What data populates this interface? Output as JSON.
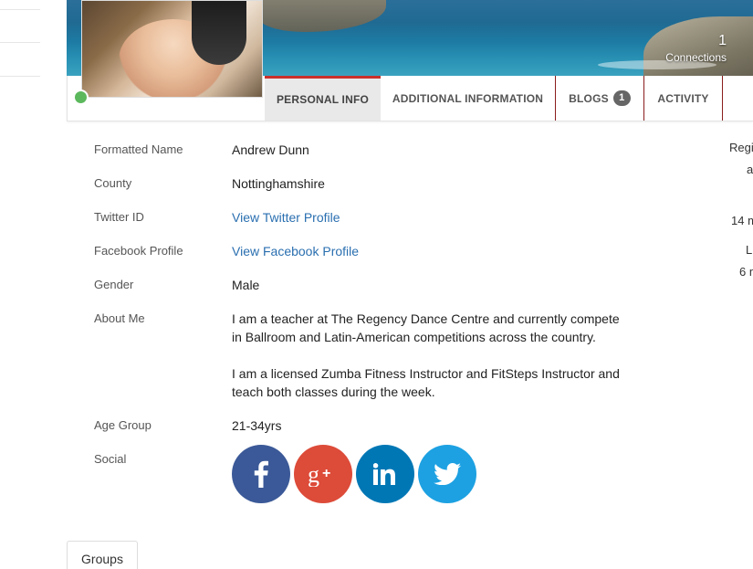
{
  "cover": {
    "connections_count": "1",
    "connections_label": "Connections"
  },
  "tabs": [
    {
      "label": "PERSONAL INFO",
      "active": true
    },
    {
      "label": "ADDITIONAL INFORMATION",
      "active": false
    },
    {
      "label": "BLOGS",
      "badge": "1",
      "active": false
    },
    {
      "label": "ACTIVITY",
      "active": false
    }
  ],
  "info": {
    "formatted_name": {
      "label": "Formatted Name",
      "value": "Andrew Dunn"
    },
    "county": {
      "label": "County",
      "value": "Nottinghamshire"
    },
    "twitter": {
      "label": "Twitter ID",
      "value": "View Twitter Profile"
    },
    "facebook": {
      "label": "Facebook Profile",
      "value": "View Facebook Profile"
    },
    "gender": {
      "label": "Gender",
      "value": "Male"
    },
    "about": {
      "label": "About Me",
      "p1": "I am a teacher at The Regency Dance Centre and currently compete in Ballroom and Latin-American competitions across the country.",
      "p2": "I am a licensed Zumba Fitness Instructor and FitSteps Instructor and teach both classes during the week."
    },
    "age_group": {
      "label": "Age Group",
      "value": "21-34yrs"
    },
    "social": {
      "label": "Social"
    }
  },
  "side_right": [
    "Regis",
    "a",
    "14 m",
    "L",
    "6 m"
  ],
  "groups": {
    "label": "Groups"
  },
  "colors": {
    "accent_red": "#c9302c",
    "link_blue": "#2a6fb0",
    "online_green": "#5cb85c",
    "facebook": "#3b5998",
    "google_plus": "#dd4b39",
    "linkedin": "#0077b5",
    "twitter": "#1da1e2"
  },
  "icons": [
    "facebook-icon",
    "google-plus-icon",
    "linkedin-icon",
    "twitter-icon"
  ]
}
